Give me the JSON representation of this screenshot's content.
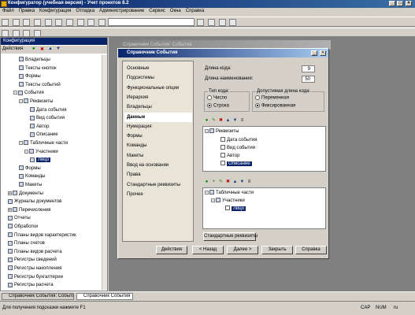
{
  "app": {
    "title": "Конфигуратор (учебная версия) - Учет проектов 8.2"
  },
  "menu": [
    "Файл",
    "Правка",
    "Конфигурация",
    "Отладка",
    "Администрирование",
    "Сервис",
    "Окна",
    "Справка"
  ],
  "config_panel": {
    "title": "Конфигурация",
    "actions_label": "Действия",
    "items": [
      {
        "label": "Владельцы",
        "indent": 3,
        "expand": ""
      },
      {
        "label": "Тексты кнопок",
        "indent": 3,
        "expand": ""
      },
      {
        "label": "Формы",
        "indent": 3,
        "expand": ""
      },
      {
        "label": "Тексты событий",
        "indent": 3,
        "expand": ""
      },
      {
        "label": "События",
        "indent": 2,
        "expand": "-"
      },
      {
        "label": "Реквизиты",
        "indent": 3,
        "expand": "-"
      },
      {
        "label": "Дата события",
        "indent": 5,
        "expand": ""
      },
      {
        "label": "Вид события",
        "indent": 5,
        "expand": ""
      },
      {
        "label": "Автор",
        "indent": 5,
        "expand": ""
      },
      {
        "label": "Описание",
        "indent": 5,
        "expand": ""
      },
      {
        "label": "Табличные части",
        "indent": 3,
        "expand": "-"
      },
      {
        "label": "Участники",
        "indent": 4,
        "expand": "-"
      },
      {
        "label": "Лицо",
        "indent": 5,
        "expand": "",
        "selected": true
      },
      {
        "label": "Формы",
        "indent": 3,
        "expand": ""
      },
      {
        "label": "Команды",
        "indent": 3,
        "expand": ""
      },
      {
        "label": "Макеты",
        "indent": 3,
        "expand": ""
      },
      {
        "label": "Документы",
        "indent": 1,
        "expand": "+"
      },
      {
        "label": "Журналы документов",
        "indent": 1,
        "expand": ""
      },
      {
        "label": "Перечисления",
        "indent": 1,
        "expand": "+"
      },
      {
        "label": "Отчеты",
        "indent": 1,
        "expand": ""
      },
      {
        "label": "Обработки",
        "indent": 1,
        "expand": ""
      },
      {
        "label": "Планы видов характеристик",
        "indent": 1,
        "expand": ""
      },
      {
        "label": "Планы счетов",
        "indent": 1,
        "expand": ""
      },
      {
        "label": "Планы видов расчета",
        "indent": 1,
        "expand": ""
      },
      {
        "label": "Регистры сведений",
        "indent": 1,
        "expand": ""
      },
      {
        "label": "Регистры накопления",
        "indent": 1,
        "expand": ""
      },
      {
        "label": "Регистры бухгалтерии",
        "indent": 1,
        "expand": ""
      },
      {
        "label": "Регистры расчета",
        "indent": 1,
        "expand": ""
      }
    ]
  },
  "bg_window": {
    "title": "Справочник События: События"
  },
  "dialog": {
    "title": "Справочник События",
    "tabs": [
      "Основные",
      "Подсистемы",
      "Функциональные опции",
      "Иерархия",
      "Владельцы",
      "Данные",
      "Нумерация",
      "Формы",
      "Команды",
      "Макеты",
      "Ввод на основании",
      "Права",
      "Стандартные реквизиты",
      "Прочее"
    ],
    "selected_tab": 5,
    "code_length_label": "Длина кода:",
    "code_length_value": "9",
    "name_length_label": "Длина наименования:",
    "name_length_value": "50",
    "code_type_group": "Тип кода:",
    "code_type_options": [
      "Число",
      "Строка"
    ],
    "code_type_selected": 1,
    "allowed_length_group": "Допустимая длина кода:",
    "allowed_length_options": [
      "Переменная",
      "Фиксированная"
    ],
    "allowed_length_selected": 1,
    "attributes_root": "Реквизиты",
    "attributes": [
      "Дата события",
      "Вид события",
      "Автор",
      "Описание"
    ],
    "selected_attribute": 3,
    "tabular_root": "Табличные части",
    "tabular_section": "Участники",
    "tabular_attribute": "Лицо",
    "std_attrs_button": "Стандартные реквизиты",
    "buttons": [
      "Действия",
      "< Назад",
      "Далее >",
      "Закрыть",
      "Справка"
    ]
  },
  "taskbar": [
    "Справочник События: События",
    "Справочник События"
  ],
  "statusbar": {
    "hint": "Для получения подсказки нажмите F1",
    "cap": "CAP",
    "num": "NUM",
    "lang": "ru"
  }
}
